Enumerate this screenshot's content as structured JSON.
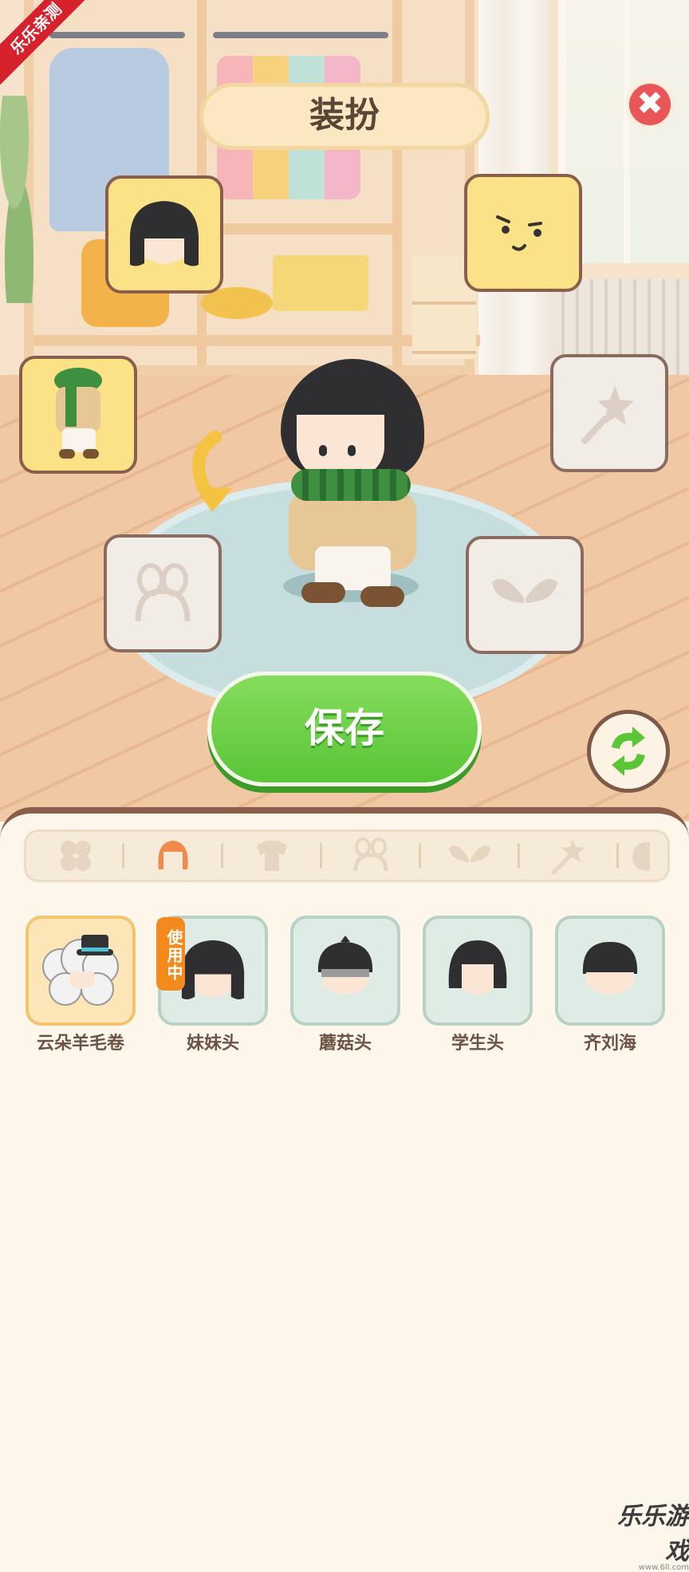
{
  "corner_ribbon": "乐乐亲测",
  "title": "装扮",
  "close_symbol": "✖",
  "slots": [
    {
      "name": "hair-slot",
      "state": "filled",
      "icon": "bob-hair-icon"
    },
    {
      "name": "expression-slot",
      "state": "filled",
      "icon": "smirk-face-icon"
    },
    {
      "name": "outfit-slot",
      "state": "filled",
      "icon": "scarf-coat-outfit-icon"
    },
    {
      "name": "hand-item-slot",
      "state": "empty",
      "icon": "star-wand-icon"
    },
    {
      "name": "headwear-slot",
      "state": "empty",
      "icon": "bunny-ears-headband-icon"
    },
    {
      "name": "wings-slot",
      "state": "empty",
      "icon": "wings-icon"
    }
  ],
  "save_button": "保存",
  "refresh_icon": "refresh-arrows-icon",
  "tabs": [
    {
      "name": "tab-all",
      "icon": "four-leaf-icon",
      "active": false
    },
    {
      "name": "tab-hair",
      "icon": "hair-icon",
      "active": true
    },
    {
      "name": "tab-clothes",
      "icon": "clothes-icon",
      "active": false
    },
    {
      "name": "tab-headwear",
      "icon": "headband-icon",
      "active": false
    },
    {
      "name": "tab-wings",
      "icon": "wings-icon",
      "active": false
    },
    {
      "name": "tab-wand",
      "icon": "wand-icon",
      "active": false
    },
    {
      "name": "tab-more",
      "icon": "partial-icon",
      "active": false
    }
  ],
  "items": [
    {
      "label": "云朵羊毛卷",
      "selected": true
    },
    {
      "label": "妹妹头",
      "selected": false,
      "badge": "使用中"
    },
    {
      "label": "蘑菇头",
      "selected": false
    },
    {
      "label": "学生头",
      "selected": false
    },
    {
      "label": "齐刘海",
      "selected": false
    }
  ],
  "watermark": {
    "brand": "乐乐游戏",
    "url": "www.6ll.com"
  },
  "colors": {
    "accent_green": "#59c537",
    "close_red": "#e8565a",
    "slot_yellow": "#fbe286",
    "badge_orange": "#f28a1e",
    "active_tab": "#f08a4b"
  }
}
